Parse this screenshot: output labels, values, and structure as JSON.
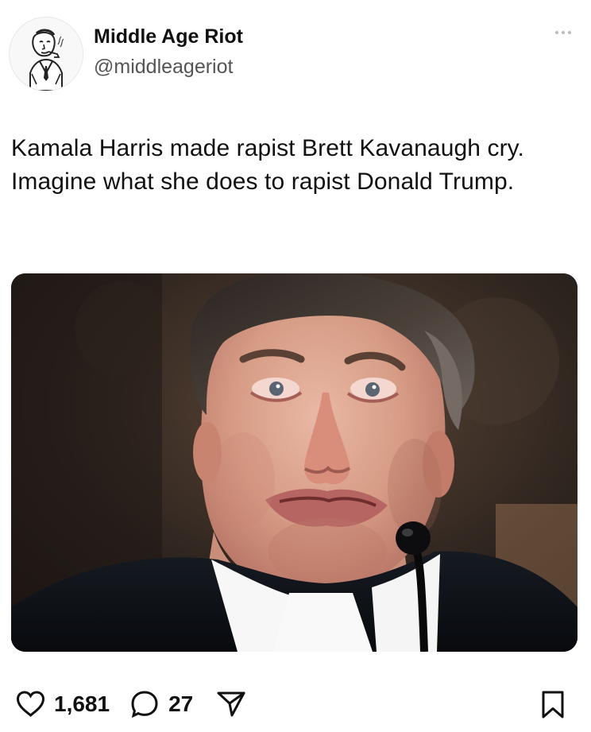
{
  "header": {
    "display_name": "Middle Age Riot",
    "handle": "@middleageriot",
    "avatar_icon": "retro-man-with-pipe-illustration-icon",
    "more_icon": "more-options-icon"
  },
  "post": {
    "text": "Kamala Harris made rapist Brett Kavanaugh cry. Imagine what she does to rapist Donald Trump.",
    "image_icon": "photo-man-crying-at-hearing"
  },
  "actions": {
    "like_icon": "heart-icon",
    "like_count": "1,681",
    "reply_icon": "comment-bubble-icon",
    "reply_count": "27",
    "share_icon": "send-icon",
    "bookmark_icon": "bookmark-icon"
  },
  "colors": {
    "text": "#111111",
    "handle": "#555555",
    "muted": "#bdbdbd",
    "background": "#ffffff"
  }
}
